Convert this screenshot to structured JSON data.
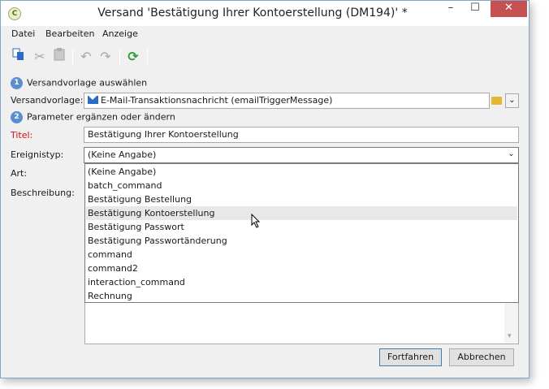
{
  "window": {
    "title": "Versand 'Bestätigung Ihrer Kontoerstellung (DM194)' *",
    "app_icon": "adobe-campaign-icon",
    "controls": {
      "minimize": "–",
      "maximize": "☐",
      "close": "✕"
    }
  },
  "menu": [
    "Datei",
    "Bearbeiten",
    "Anzeige"
  ],
  "toolbar": {
    "icons": [
      "copy-icon",
      "cut-icon",
      "paste-icon",
      "undo-icon",
      "redo-icon",
      "refresh-icon"
    ]
  },
  "step1": {
    "number": "1",
    "label": "Versandvorlage auswählen"
  },
  "template": {
    "label": "Versandvorlage:",
    "value": "E-Mail-Transaktionsnachricht (emailTriggerMessage)"
  },
  "step2": {
    "number": "2",
    "label": "Parameter ergänzen oder ändern"
  },
  "title_field": {
    "label": "Titel:",
    "value": "Bestätigung Ihrer Kontoerstellung"
  },
  "event_type": {
    "label": "Ereignistyp:",
    "value": "(Keine Angabe)",
    "options": [
      "(Keine Angabe)",
      "batch_command",
      "Bestätigung Bestellung",
      "Bestätigung Kontoerstellung",
      "Bestätigung Passwort",
      "Bestätigung Passwortänderung",
      "command",
      "command2",
      "interaction_command",
      "Rechnung"
    ],
    "hovered_option": "Bestätigung Kontoerstellung"
  },
  "art_label": "Art:",
  "description_label": "Beschreibung:",
  "buttons": {
    "continue": "Fortfahren",
    "cancel": "Abbrechen"
  },
  "colors": {
    "step_badge": "#5b8ed1",
    "required_label": "#d01010",
    "close_button": "#c75050"
  }
}
